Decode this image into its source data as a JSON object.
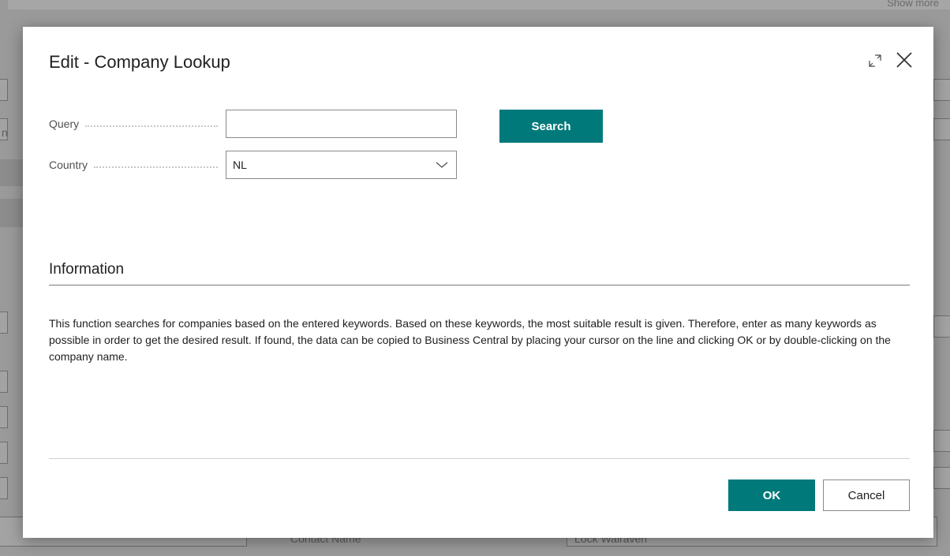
{
  "background": {
    "show_more": "Show more",
    "left_clip_letter": "n",
    "contact_name_label": "Contact Name",
    "bottom_field_value": "Lock Walraven"
  },
  "dialog": {
    "title": "Edit - Company Lookup",
    "expand_icon": "expand-icon",
    "close_icon": "close-icon",
    "fields": {
      "query": {
        "label": "Query",
        "value": ""
      },
      "country": {
        "label": "Country",
        "value": "NL"
      }
    },
    "search_label": "Search",
    "information": {
      "heading": "Information",
      "text": "This function searches for companies based on the entered keywords. Based on these keywords, the most suitable result is given. Therefore, enter as many keywords as possible in order to get the desired result. If found, the data can be copied to Business Central by placing your cursor on the line and clicking OK or by double-clicking on the company name."
    },
    "ok_label": "OK",
    "cancel_label": "Cancel"
  },
  "colors": {
    "accent": "#00797b",
    "text": "#212121",
    "label": "#505050"
  }
}
